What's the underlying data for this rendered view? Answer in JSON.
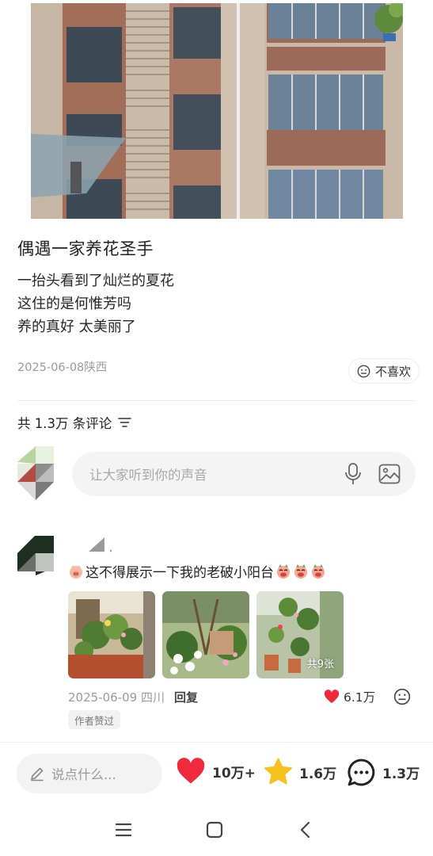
{
  "post": {
    "title": "偶遇一家养花圣手",
    "body": [
      "一抬头看到了灿烂的夏花",
      "这住的是何惟芳吗",
      "养的真好 太美丽了"
    ],
    "date_location": "2025-06-08陕西",
    "dislike_label": "不喜欢"
  },
  "comments": {
    "count_label": "共 1.3万 条评论",
    "input_placeholder": "让大家听到你的声音"
  },
  "comment": {
    "text": "这不得展示一下我的老破小阳台",
    "image_count_label": "共9张",
    "date_location": "2025-06-09 四川",
    "reply_label": "回复",
    "likes": "6.1万",
    "author_badge": "作者赞过"
  },
  "bottom_bar": {
    "input_placeholder": "说点什么...",
    "likes": "10万+",
    "favorites": "1.6万",
    "comments": "1.3万"
  },
  "colors": {
    "like_red": "#ee2a3c",
    "star_yellow": "#f8c21c"
  },
  "icons": [
    "mic-icon",
    "image-icon",
    "filter-icon",
    "heart-icon",
    "star-icon",
    "comment-bubble-icon",
    "pencil-icon",
    "menu-icon",
    "home-icon",
    "back-icon",
    "neutral-face-icon"
  ]
}
